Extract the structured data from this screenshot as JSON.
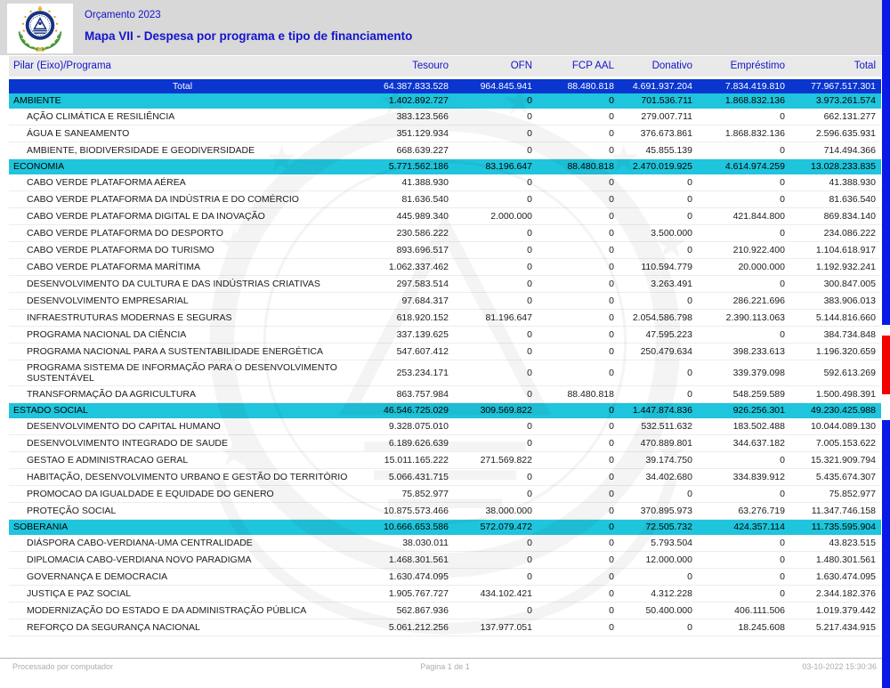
{
  "header": {
    "doc_title": "Orçamento 2023",
    "map_title": "Mapa VII - Despesa por programa e tipo de financiamento",
    "logo": "cabo-verde-coat-of-arms"
  },
  "colors": {
    "top_band": "#d8d8d8",
    "column_header_bg": "#e9e9e9",
    "title_blue": "#1414cc",
    "total_row_blue": "#0a35cf",
    "section_cyan": "#1fc5dc",
    "flag_blue": "#0a1ae6",
    "flag_red": "#f50000"
  },
  "table": {
    "columns": [
      "Pilar (Eixo)/Programa",
      "Tesouro",
      "OFN",
      "FCP AAL",
      "Donativo",
      "Empréstimo",
      "Total"
    ],
    "total_row": {
      "label": "Total",
      "values": [
        "64.387.833.528",
        "964.845.941",
        "88.480.818",
        "4.691.937.204",
        "7.834.419.810",
        "77.967.517.301"
      ]
    },
    "sections": [
      {
        "name": "AMBIENTE",
        "values": [
          "1.402.892.727",
          "0",
          "0",
          "701.536.711",
          "1.868.832.136",
          "3.973.261.574"
        ],
        "rows": [
          {
            "program": "AÇÃO CLIMÁTICA E RESILIÊNCIA",
            "values": [
              "383.123.566",
              "0",
              "0",
              "279.007.711",
              "0",
              "662.131.277"
            ]
          },
          {
            "program": "ÁGUA E SANEAMENTO",
            "values": [
              "351.129.934",
              "0",
              "0",
              "376.673.861",
              "1.868.832.136",
              "2.596.635.931"
            ]
          },
          {
            "program": "AMBIENTE, BIODIVERSIDADE E GEODIVERSIDADE",
            "values": [
              "668.639.227",
              "0",
              "0",
              "45.855.139",
              "0",
              "714.494.366"
            ]
          }
        ]
      },
      {
        "name": "ECONOMIA",
        "values": [
          "5.771.562.186",
          "83.196.647",
          "88.480.818",
          "2.470.019.925",
          "4.614.974.259",
          "13.028.233.835"
        ],
        "rows": [
          {
            "program": "CABO VERDE PLATAFORMA AÉREA",
            "values": [
              "41.388.930",
              "0",
              "0",
              "0",
              "0",
              "41.388.930"
            ]
          },
          {
            "program": "CABO VERDE PLATAFORMA DA INDÚSTRIA E DO COMÉRCIO",
            "values": [
              "81.636.540",
              "0",
              "0",
              "0",
              "0",
              "81.636.540"
            ]
          },
          {
            "program": "CABO VERDE PLATAFORMA DIGITAL E DA INOVAÇÃO",
            "values": [
              "445.989.340",
              "2.000.000",
              "0",
              "0",
              "421.844.800",
              "869.834.140"
            ]
          },
          {
            "program": "CABO VERDE PLATAFORMA DO DESPORTO",
            "values": [
              "230.586.222",
              "0",
              "0",
              "3.500.000",
              "0",
              "234.086.222"
            ]
          },
          {
            "program": "CABO VERDE PLATAFORMA DO TURISMO",
            "values": [
              "893.696.517",
              "0",
              "0",
              "0",
              "210.922.400",
              "1.104.618.917"
            ]
          },
          {
            "program": "CABO VERDE PLATAFORMA MARÍTIMA",
            "values": [
              "1.062.337.462",
              "0",
              "0",
              "110.594.779",
              "20.000.000",
              "1.192.932.241"
            ]
          },
          {
            "program": "DESENVOLVIMENTO DA CULTURA E DAS INDÚSTRIAS CRIATIVAS",
            "values": [
              "297.583.514",
              "0",
              "0",
              "3.263.491",
              "0",
              "300.847.005"
            ]
          },
          {
            "program": "DESENVOLVIMENTO EMPRESARIAL",
            "values": [
              "97.684.317",
              "0",
              "0",
              "0",
              "286.221.696",
              "383.906.013"
            ]
          },
          {
            "program": "INFRAESTRUTURAS MODERNAS E SEGURAS",
            "values": [
              "618.920.152",
              "81.196.647",
              "0",
              "2.054.586.798",
              "2.390.113.063",
              "5.144.816.660"
            ]
          },
          {
            "program": "PROGRAMA NACIONAL DA CIÊNCIA",
            "values": [
              "337.139.625",
              "0",
              "0",
              "47.595.223",
              "0",
              "384.734.848"
            ]
          },
          {
            "program": "PROGRAMA NACIONAL PARA A SUSTENTABILIDADE ENERGÉTICA",
            "values": [
              "547.607.412",
              "0",
              "0",
              "250.479.634",
              "398.233.613",
              "1.196.320.659"
            ]
          },
          {
            "program": "PROGRAMA SISTEMA DE INFORMAÇÃO PARA O DESENVOLVIMENTO SUSTENTÁVEL",
            "values": [
              "253.234.171",
              "0",
              "0",
              "0",
              "339.379.098",
              "592.613.269"
            ]
          },
          {
            "program": "TRANSFORMAÇÃO DA AGRICULTURA",
            "values": [
              "863.757.984",
              "0",
              "88.480.818",
              "0",
              "548.259.589",
              "1.500.498.391"
            ]
          }
        ]
      },
      {
        "name": "ESTADO SOCIAL",
        "values": [
          "46.546.725.029",
          "309.569.822",
          "0",
          "1.447.874.836",
          "926.256.301",
          "49.230.425.988"
        ],
        "rows": [
          {
            "program": "DESENVOLVIMENTO DO CAPITAL HUMANO",
            "values": [
              "9.328.075.010",
              "0",
              "0",
              "532.511.632",
              "183.502.488",
              "10.044.089.130"
            ]
          },
          {
            "program": "DESENVOLVIMENTO INTEGRADO DE SAUDE",
            "values": [
              "6.189.626.639",
              "0",
              "0",
              "470.889.801",
              "344.637.182",
              "7.005.153.622"
            ]
          },
          {
            "program": "GESTAO E ADMINISTRACAO GERAL",
            "values": [
              "15.011.165.222",
              "271.569.822",
              "0",
              "39.174.750",
              "0",
              "15.321.909.794"
            ]
          },
          {
            "program": "HABITAÇÃO, DESENVOLVIMENTO URBANO E GESTÃO DO TERRITÓRIO",
            "values": [
              "5.066.431.715",
              "0",
              "0",
              "34.402.680",
              "334.839.912",
              "5.435.674.307"
            ]
          },
          {
            "program": "PROMOCAO DA IGUALDADE E EQUIDADE DO GENERO",
            "values": [
              "75.852.977",
              "0",
              "0",
              "0",
              "0",
              "75.852.977"
            ]
          },
          {
            "program": "PROTEÇÃO SOCIAL",
            "values": [
              "10.875.573.466",
              "38.000.000",
              "0",
              "370.895.973",
              "63.276.719",
              "11.347.746.158"
            ]
          }
        ]
      },
      {
        "name": "SOBERANIA",
        "values": [
          "10.666.653.586",
          "572.079.472",
          "0",
          "72.505.732",
          "424.357.114",
          "11.735.595.904"
        ],
        "rows": [
          {
            "program": "DIÁSPORA CABO-VERDIANA-UMA CENTRALIDADE",
            "values": [
              "38.030.011",
              "0",
              "0",
              "5.793.504",
              "0",
              "43.823.515"
            ]
          },
          {
            "program": "DIPLOMACIA CABO-VERDIANA NOVO PARADIGMA",
            "values": [
              "1.468.301.561",
              "0",
              "0",
              "12.000.000",
              "0",
              "1.480.301.561"
            ]
          },
          {
            "program": "GOVERNANÇA E DEMOCRACIA",
            "values": [
              "1.630.474.095",
              "0",
              "0",
              "0",
              "0",
              "1.630.474.095"
            ]
          },
          {
            "program": "JUSTIÇA E PAZ SOCIAL",
            "values": [
              "1.905.767.727",
              "434.102.421",
              "0",
              "4.312.228",
              "0",
              "2.344.182.376"
            ]
          },
          {
            "program": "MODERNIZAÇÃO DO ESTADO E DA ADMINISTRAÇÃO PÚBLICA",
            "values": [
              "562.867.936",
              "0",
              "0",
              "50.400.000",
              "406.111.506",
              "1.019.379.442"
            ]
          },
          {
            "program": "REFORÇO DA SEGURANÇA NACIONAL",
            "values": [
              "5.061.212.256",
              "137.977.051",
              "0",
              "0",
              "18.245.608",
              "5.217.434.915"
            ]
          }
        ]
      }
    ]
  },
  "footer": {
    "left": "Processado por computador",
    "center": "Pagina 1 de 1",
    "right": "03-10-2022   15:30:36"
  }
}
